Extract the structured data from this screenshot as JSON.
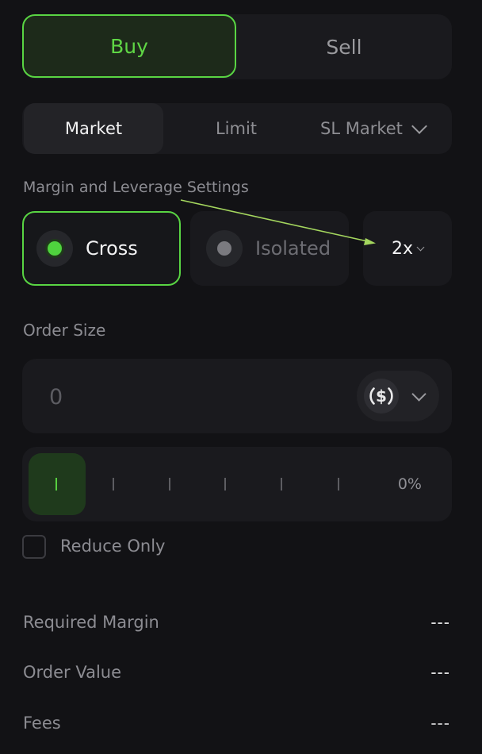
{
  "side_tabs": {
    "buy_label": "Buy",
    "sell_label": "Sell",
    "active": "Buy"
  },
  "order_types": {
    "items": [
      "Market",
      "Limit",
      "SL Market"
    ],
    "active": "Market"
  },
  "margin": {
    "section_label": "Margin and Leverage Settings",
    "cross_label": "Cross",
    "isolated_label": "Isolated",
    "selected": "Cross",
    "leverage": "2x"
  },
  "order_size": {
    "label": "Order Size",
    "placeholder": "0",
    "currency_icon": "usdc-dollar-icon"
  },
  "slider": {
    "percent_label": "0%",
    "value": 0
  },
  "reduce_only": {
    "label": "Reduce Only",
    "checked": false
  },
  "summary": {
    "required_margin_label": "Required Margin",
    "required_margin_value": "---",
    "order_value_label": "Order Value",
    "order_value_value": "---",
    "fees_label": "Fees",
    "fees_value": "---"
  },
  "colors": {
    "accent_green": "#59d543",
    "background": "#121215",
    "surface": "#1a1a1e",
    "annotation_arrow": "#a4d65e"
  }
}
